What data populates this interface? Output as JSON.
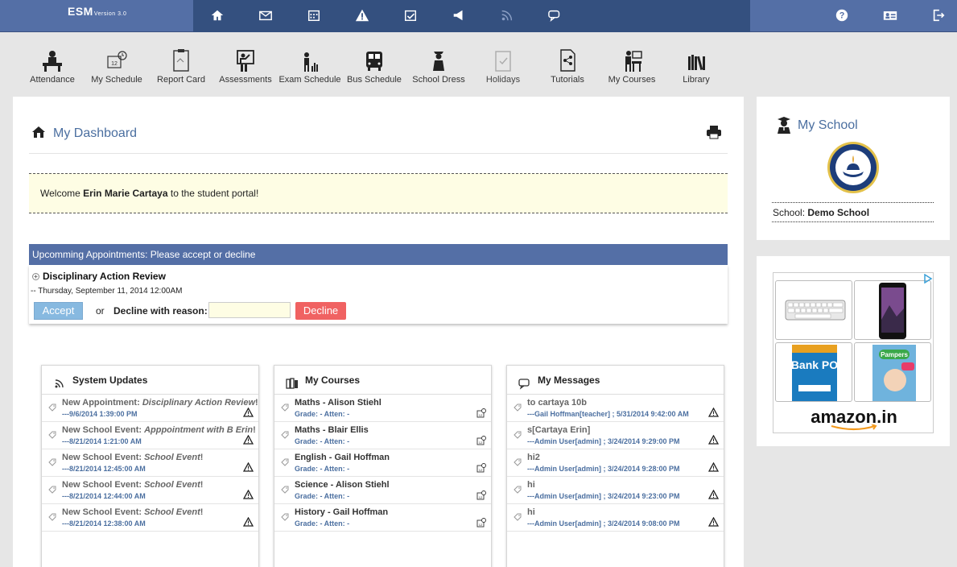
{
  "brand": {
    "name": "ESM",
    "version": "Version 3.0"
  },
  "top_nav": [
    {
      "icon": "home-icon"
    },
    {
      "icon": "mail-icon"
    },
    {
      "icon": "calendar-icon"
    },
    {
      "icon": "alert-icon"
    },
    {
      "icon": "calendar-check-icon"
    },
    {
      "icon": "megaphone-icon"
    },
    {
      "icon": "rss-icon"
    },
    {
      "icon": "chat-icon"
    }
  ],
  "top_right": [
    {
      "icon": "help-icon"
    },
    {
      "icon": "profile-card-icon"
    },
    {
      "icon": "logout-icon"
    }
  ],
  "toolbar": [
    {
      "label": "Attendance"
    },
    {
      "label": "My Schedule"
    },
    {
      "label": "Report Card"
    },
    {
      "label": "Assessments"
    },
    {
      "label": "Exam Schedule"
    },
    {
      "label": "Bus Schedule"
    },
    {
      "label": "School Dress"
    },
    {
      "label": "Holidays"
    },
    {
      "label": "Tutorials"
    },
    {
      "label": "My Courses"
    },
    {
      "label": "Library"
    }
  ],
  "dashboard": {
    "title": "My Dashboard",
    "welcome_prefix": "Welcome ",
    "welcome_name": "Erin Marie Cartaya",
    "welcome_suffix": " to the student portal!"
  },
  "appointments": {
    "header": "Upcomming Appointments: Please accept or decline",
    "title": "Disciplinary Action Review",
    "date": "-- Thursday, September 11, 2014 12:00AM",
    "accept": "Accept",
    "or": "or",
    "decline_label": "Decline with reason:",
    "decline_placeholder": "",
    "decline": "Decline"
  },
  "system_updates": {
    "title": "System Updates",
    "items": [
      {
        "prefix": "New Appointment: ",
        "name": "Disciplinary Action Review",
        "suffix": "!",
        "date": "---9/6/2014 1:39:00 PM"
      },
      {
        "prefix": "New School Event: ",
        "name": "Apppointment with B Erin",
        "suffix": "!",
        "date": "---8/21/2014 1:21:00 AM"
      },
      {
        "prefix": "New School Event: ",
        "name": "School Event",
        "suffix": "!",
        "date": "---8/21/2014 12:45:00 AM"
      },
      {
        "prefix": "New School Event: ",
        "name": "School Event",
        "suffix": "!",
        "date": "---8/21/2014 12:44:00 AM"
      },
      {
        "prefix": "New School Event: ",
        "name": "School Event",
        "suffix": "!",
        "date": "---8/21/2014 12:38:00 AM"
      }
    ]
  },
  "my_courses": {
    "title": "My Courses",
    "items": [
      {
        "name": "Maths - Alison Stiehl",
        "info": "Grade: - Atten: -"
      },
      {
        "name": "Maths - Blair Ellis",
        "info": "Grade: - Atten: -"
      },
      {
        "name": "English - Gail Hoffman",
        "info": "Grade: - Atten: -"
      },
      {
        "name": "Science - Alison Stiehl",
        "info": "Grade: - Atten: -"
      },
      {
        "name": "History - Gail Hoffman",
        "info": "Grade: - Atten: -"
      }
    ]
  },
  "my_messages": {
    "title": "My Messages",
    "items": [
      {
        "subject": "to cartaya 10b",
        "meta": "---Gail Hoffman[teacher] ; 5/31/2014 9:42:00 AM"
      },
      {
        "subject": "s[Cartaya Erin]",
        "meta": "---Admin User[admin] ; 3/24/2014 9:29:00 PM"
      },
      {
        "subject": "hi2",
        "meta": "---Admin User[admin] ; 3/24/2014 9:28:00 PM"
      },
      {
        "subject": "hi",
        "meta": "---Admin User[admin] ; 3/24/2014 9:23:00 PM"
      },
      {
        "subject": "hi",
        "meta": "---Admin User[admin] ; 3/24/2014 9:08:00 PM"
      }
    ]
  },
  "my_school": {
    "title": "My School",
    "label": "School: ",
    "name": "Demo School"
  },
  "ad": {
    "brand": "amazon.in",
    "choices": "D",
    "products": [
      "Bank PO",
      "Pampers"
    ]
  },
  "colors": {
    "header": "#546fa6",
    "header_dark": "#34507f",
    "accent": "#4b6fa0",
    "welcome_bg": "#fefde4",
    "decline": "#f06262",
    "accept": "#87b9e0"
  }
}
